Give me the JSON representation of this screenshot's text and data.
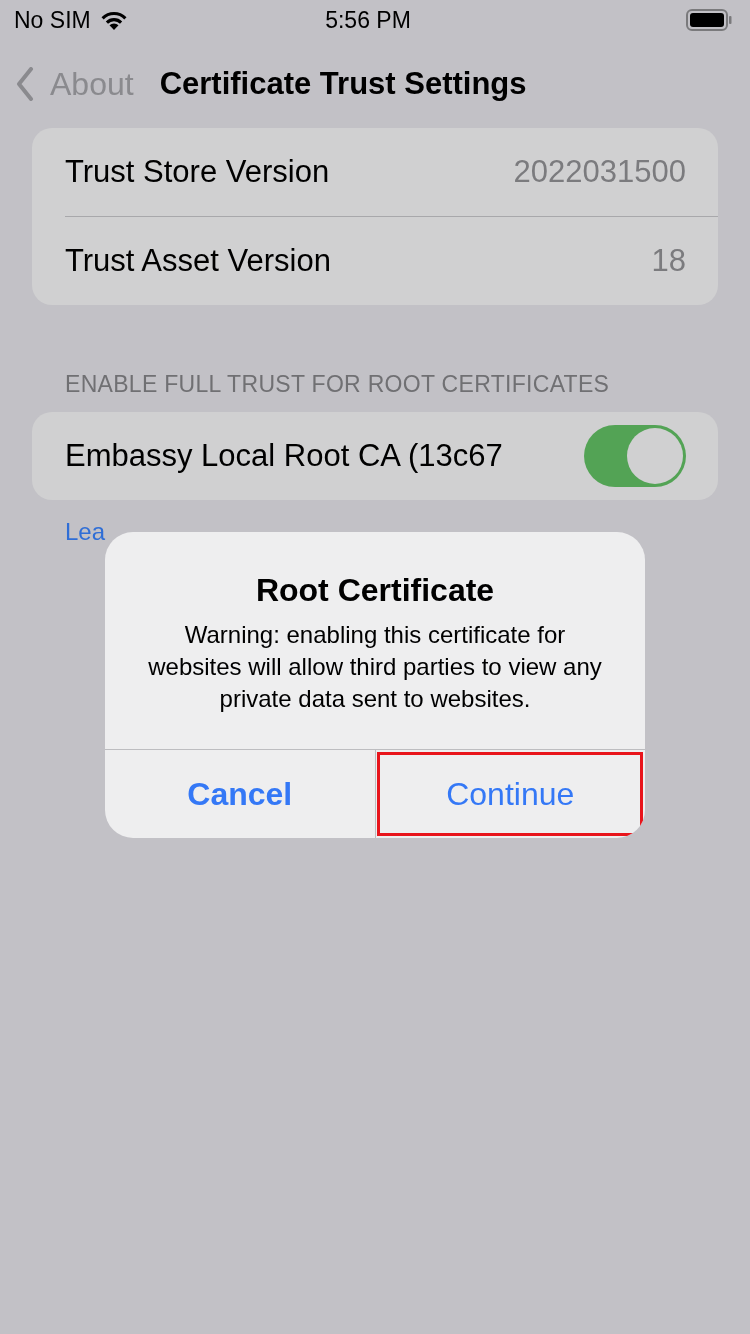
{
  "status_bar": {
    "carrier": "No SIM",
    "time": "5:56 PM"
  },
  "nav": {
    "back_label": "About",
    "title": "Certificate Trust Settings"
  },
  "info_rows": [
    {
      "label": "Trust Store Version",
      "value": "2022031500"
    },
    {
      "label": "Trust Asset Version",
      "value": "18"
    }
  ],
  "trust_section": {
    "header": "ENABLE FULL TRUST FOR ROOT CERTIFICATES",
    "certificates": [
      {
        "name": "Embassy Local Root CA (13c67",
        "on": true
      }
    ],
    "link": "Lea"
  },
  "alert": {
    "title": "Root Certificate",
    "message": "Warning: enabling this certificate for websites will allow third parties to view any private data sent to websites.",
    "buttons": [
      {
        "label": "Cancel",
        "bold": true,
        "highlighted": false
      },
      {
        "label": "Continue",
        "bold": false,
        "highlighted": true
      }
    ]
  }
}
